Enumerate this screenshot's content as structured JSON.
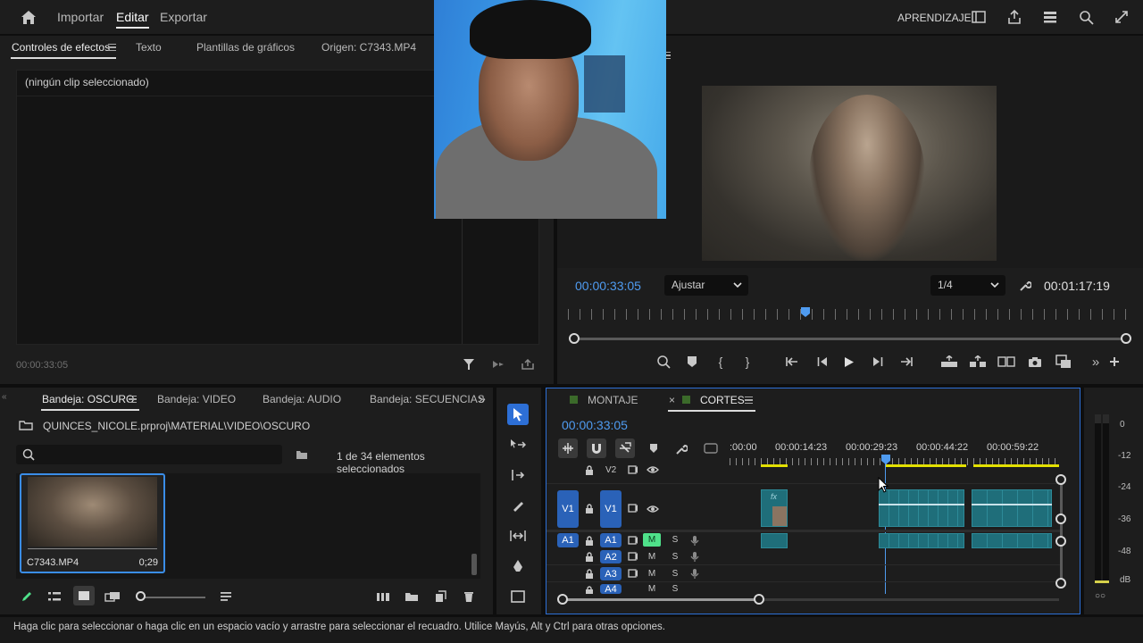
{
  "topbar": {
    "nav": [
      "Importar",
      "Editar",
      "Exportar"
    ],
    "active": "Editar",
    "workspace_label": "APRENDIZAJE"
  },
  "effect_controls": {
    "tabs": [
      "Controles de efectos",
      "Texto",
      "Plantillas de gráficos",
      "Origen: C7343.MP4"
    ],
    "empty_message": "(ningún clip seleccionado)",
    "timecode": "00:00:33:05"
  },
  "program_monitor": {
    "current_timecode": "00:00:33:05",
    "fit_label": "Ajustar",
    "resolution_label": "1/4",
    "duration": "00:01:17:19"
  },
  "project": {
    "tabs": [
      "Bandeja: OSCURO",
      "Bandeja: VIDEO",
      "Bandeja: AUDIO",
      "Bandeja: SECUENCIAS"
    ],
    "path": "QUINCES_NICOLE.prproj\\MATERIAL\\VIDEO\\OSCURO",
    "search_placeholder": "",
    "selection_count": "1 de 34 elementos seleccionados",
    "clip_name": "C7343.MP4",
    "clip_duration": "0;29"
  },
  "timeline": {
    "tabs": [
      "MONTAJE",
      "CORTES"
    ],
    "active_tab": "CORTES",
    "timecode": "00:00:33:05",
    "ruler": [
      ":00:00",
      "00:00:14:23",
      "00:00:29:23",
      "00:00:44:22",
      "00:00:59:22"
    ],
    "video_tracks": [
      "V2",
      "V1"
    ],
    "source_patch_video": "V1",
    "source_patch_audio": "A1",
    "audio_tracks": [
      "A1",
      "A2",
      "A3",
      "A4"
    ],
    "mute_label": "M",
    "solo_label": "S",
    "fx_badge": "fx"
  },
  "meter": {
    "scale": [
      "0",
      "-12",
      "-24",
      "-36",
      "-48",
      "dB"
    ]
  },
  "status_bar": {
    "hint": "Haga clic para seleccionar o haga clic en un espacio vacío y arrastre para seleccionar el recuadro. Utilice Mayús, Alt y Ctrl para otras opciones."
  },
  "colors": {
    "accent_blue": "#4f9bf0",
    "track_blue": "#2a62b8",
    "clip_teal": "#1f6e7a",
    "mute_green": "#4fe18a",
    "work_area_yellow": "#e3e000"
  }
}
